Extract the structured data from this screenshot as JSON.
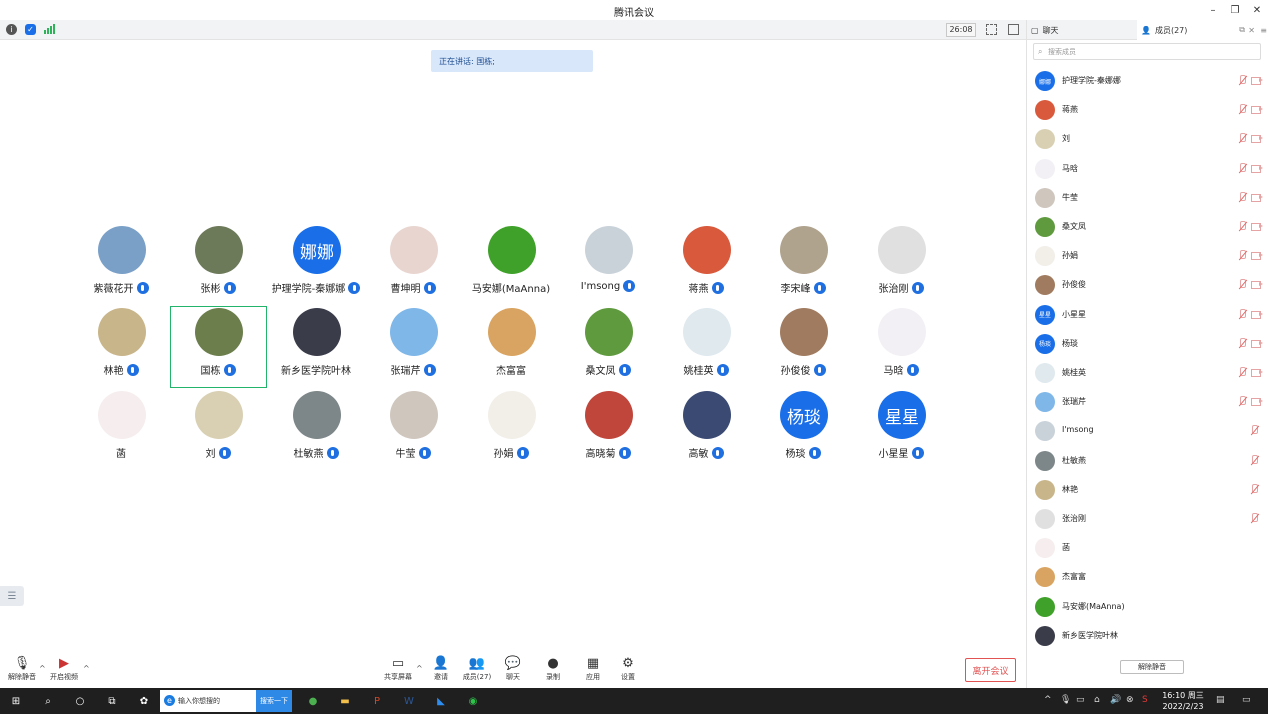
{
  "window": {
    "title": "腾讯会议",
    "minimize": "–",
    "restore": "❐",
    "close": "✕"
  },
  "topbar": {
    "timer": "26:08"
  },
  "speaking": {
    "text": "正在讲话: 国栋;"
  },
  "participants": [
    {
      "name": "紫薇花开",
      "mic": true,
      "bg": "#7aa0c8"
    },
    {
      "name": "张彬",
      "mic": true,
      "bg": "#6d7a5a"
    },
    {
      "name": "护理学院-秦娜娜",
      "mic": true,
      "bg": "#1a6fe8",
      "text": "娜娜"
    },
    {
      "name": "曹坤明",
      "mic": true,
      "bg": "#e8d5d0"
    },
    {
      "name": "马安娜(MaAnna)",
      "mic": false,
      "bg": "#3fa12a"
    },
    {
      "name": "I'msong",
      "mic": true,
      "bg": "#c9d2d9"
    },
    {
      "name": "蒋燕",
      "mic": true,
      "bg": "#d9593c"
    },
    {
      "name": "李宋峰",
      "mic": true,
      "bg": "#b0a38d"
    },
    {
      "name": "张治刚",
      "mic": true,
      "bg": "#e0e0e0"
    },
    {
      "name": "林艳",
      "mic": true,
      "bg": "#c9b58a"
    },
    {
      "name": "国栋",
      "mic": true,
      "bg": "#6b7e4c"
    },
    {
      "name": "新乡医学院叶林",
      "mic": false,
      "bg": "#3a3c4a"
    },
    {
      "name": "张瑞芹",
      "mic": true,
      "bg": "#7fb7e8"
    },
    {
      "name": "杰富富",
      "mic": false,
      "bg": "#d9a461"
    },
    {
      "name": "桑文凤",
      "mic": true,
      "bg": "#5f9a3f"
    },
    {
      "name": "姚桂英",
      "mic": true,
      "bg": "#dfe9ee"
    },
    {
      "name": "孙俊俊",
      "mic": true,
      "bg": "#a07b5f"
    },
    {
      "name": "马晗",
      "mic": true,
      "bg": "#f3f0f5"
    },
    {
      "name": "菡",
      "mic": false,
      "bg": "#f6eeee"
    },
    {
      "name": "刘",
      "mic": true,
      "bg": "#d9d0b4"
    },
    {
      "name": "杜敏燕",
      "mic": true,
      "bg": "#7d8688"
    },
    {
      "name": "牛莹",
      "mic": true,
      "bg": "#cfc6be"
    },
    {
      "name": "孙娟",
      "mic": true,
      "bg": "#f2eee8"
    },
    {
      "name": "高晓菊",
      "mic": true,
      "bg": "#c0463c"
    },
    {
      "name": "高敏",
      "mic": true,
      "bg": "#3a4a73"
    },
    {
      "name": "杨琰",
      "mic": true,
      "bg": "#1a6fe8",
      "text": "杨琰"
    },
    {
      "name": "小星星",
      "mic": true,
      "bg": "#1a6fe8",
      "text": "星星"
    }
  ],
  "sidetab": {
    "icon": "☰"
  },
  "bottombar": {
    "unmute": "解除静音",
    "video": "开启视频",
    "share": "共享屏幕",
    "invite": "邀请",
    "members": "成员(27)",
    "chat": "聊天",
    "record": "录制",
    "apps": "应用",
    "settings": "设置",
    "leave": "离开会议",
    "caret": "^"
  },
  "panel": {
    "tab_chat": "聊天",
    "tab_members": "成员(27)",
    "search_placeholder": "搜索成员",
    "unmute_all": "解除静音",
    "members": [
      {
        "name": "护理学院-秦娜娜",
        "bg": "#1a6fe8",
        "text": "娜娜",
        "cam": true
      },
      {
        "name": "蒋燕",
        "bg": "#d9593c",
        "cam": true
      },
      {
        "name": "刘",
        "bg": "#d9d0b4",
        "cam": true
      },
      {
        "name": "马晗",
        "bg": "#f3f0f5",
        "cam": true
      },
      {
        "name": "牛莹",
        "bg": "#cfc6be",
        "cam": true
      },
      {
        "name": "桑文凤",
        "bg": "#5f9a3f",
        "cam": true
      },
      {
        "name": "孙娟",
        "bg": "#f2eee8",
        "cam": true
      },
      {
        "name": "孙俊俊",
        "bg": "#a07b5f",
        "cam": true
      },
      {
        "name": "小星星",
        "bg": "#1a6fe8",
        "text": "星星",
        "cam": true
      },
      {
        "name": "杨琰",
        "bg": "#1a6fe8",
        "text": "杨琰",
        "cam": true
      },
      {
        "name": "姚桂英",
        "bg": "#dfe9ee",
        "cam": true
      },
      {
        "name": "张瑞芹",
        "bg": "#7fb7e8",
        "cam": true
      },
      {
        "name": "I'msong",
        "bg": "#c9d2d9",
        "cam": false
      },
      {
        "name": "杜敏燕",
        "bg": "#7d8688",
        "cam": false
      },
      {
        "name": "林艳",
        "bg": "#c9b58a",
        "cam": false
      },
      {
        "name": "张治刚",
        "bg": "#e0e0e0",
        "cam": false
      },
      {
        "name": "菡",
        "bg": "#f6eeee",
        "cam": false,
        "nomic": true
      },
      {
        "name": "杰富富",
        "bg": "#d9a461",
        "cam": false,
        "nomic": true
      },
      {
        "name": "马安娜(MaAnna)",
        "bg": "#3fa12a",
        "cam": false,
        "nomic": true
      },
      {
        "name": "新乡医学院叶林",
        "bg": "#3a3c4a",
        "cam": false,
        "nomic": true
      }
    ]
  },
  "taskbar": {
    "search_placeholder": "输入你想搜的",
    "search_button": "搜索一下",
    "time": "16:10 周三",
    "date": "2022/2/23"
  },
  "colors": {
    "accent": "#1a6fe8",
    "leave": "#e15252",
    "highlight": "#23b46b"
  }
}
